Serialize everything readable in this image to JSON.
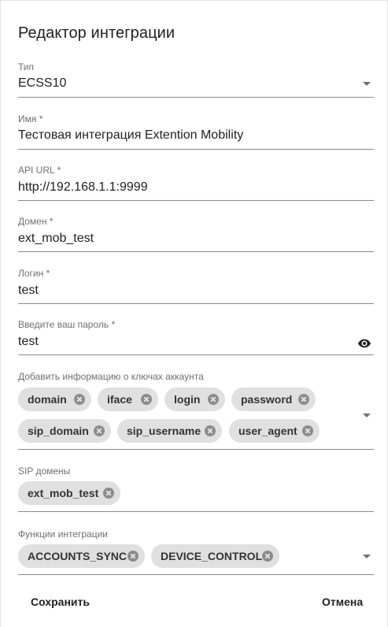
{
  "dialog": {
    "title": "Редактор интеграции"
  },
  "fields": {
    "type": {
      "label": "Тип",
      "value": "ECSS10"
    },
    "name": {
      "label": "Имя *",
      "value": "Тестовая интеграция Extention Mobility"
    },
    "api_url": {
      "label": "API URL *",
      "value": "http://192.168.1.1:9999"
    },
    "domain": {
      "label": "Домен *",
      "value": "ext_mob_test"
    },
    "login": {
      "label": "Логин *",
      "value": "test"
    },
    "password": {
      "label": "Введите ваш пароль *",
      "value": "test"
    },
    "account_keys": {
      "label": "Добавить информацию о ключах аккаунта",
      "chips": [
        "domain",
        "iface",
        "login",
        "password",
        "sip_domain",
        "sip_username",
        "user_agent"
      ]
    },
    "sip_domains": {
      "label": "SIP домены",
      "chips": [
        "ext_mob_test"
      ]
    },
    "functions": {
      "label": "Функции интеграции",
      "chips": [
        "ACCOUNTS_SYNC",
        "DEVICE_CONTROL"
      ]
    }
  },
  "actions": {
    "save": "Сохранить",
    "cancel": "Отмена"
  },
  "icons": {
    "dropdown": "arrow-drop-down-icon",
    "visibility": "eye-icon",
    "chip_remove": "cancel-circle-icon"
  },
  "colors": {
    "chip_bg": "#e0e0e0",
    "label": "#6f6f6f",
    "underline": "#8a8a8a",
    "text": "#212121"
  }
}
